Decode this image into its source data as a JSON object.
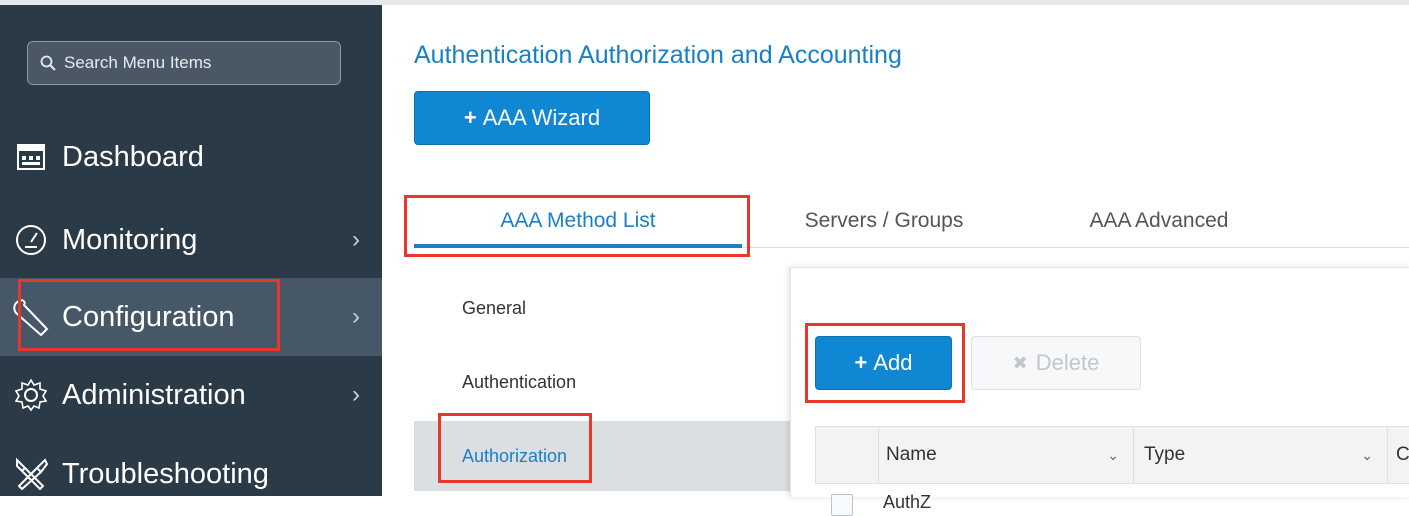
{
  "search": {
    "placeholder": "Search Menu Items"
  },
  "sidebar": {
    "items": [
      {
        "label": "Dashboard",
        "icon": "dashboard-icon"
      },
      {
        "label": "Monitoring",
        "icon": "gauge-icon",
        "chevron": "›"
      },
      {
        "label": "Configuration",
        "icon": "wrench-icon",
        "chevron": "›"
      },
      {
        "label": "Administration",
        "icon": "gear-icon",
        "chevron": "›"
      },
      {
        "label": "Troubleshooting",
        "icon": "tools-icon"
      }
    ]
  },
  "main": {
    "title": "Authentication Authorization and Accounting",
    "wizard_label": "AAA Wizard",
    "plus": "+",
    "tabs": [
      {
        "label": "AAA Method List"
      },
      {
        "label": "Servers / Groups"
      },
      {
        "label": "AAA Advanced"
      }
    ],
    "subnav": [
      {
        "label": "General"
      },
      {
        "label": "Authentication"
      },
      {
        "label": "Authorization"
      }
    ],
    "panel": {
      "add_label": "Add",
      "delete_label": "Delete",
      "delete_icon": "✖",
      "columns": [
        {
          "label": "Name",
          "sort": "⌄"
        },
        {
          "label": "Type",
          "sort": "⌄"
        },
        {
          "label": "C"
        }
      ],
      "partial_row_text": "AuthZ"
    }
  },
  "colors": {
    "sidebar_bg": "#2b3a47",
    "accent_blue": "#1a80c4",
    "button_blue": "#0f87d2",
    "highlight_red": "#e8372b"
  }
}
